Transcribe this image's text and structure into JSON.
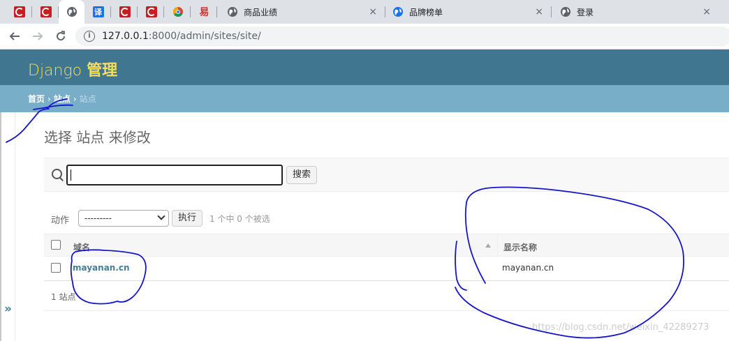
{
  "browser": {
    "tabs": [
      {
        "icon": "csdn-icon"
      },
      {
        "icon": "csdn-icon"
      },
      {
        "icon": "globe-icon",
        "active": true
      },
      {
        "icon": "translate-icon",
        "glyph": "译"
      },
      {
        "icon": "csdn-icon"
      },
      {
        "icon": "csdn-icon"
      },
      {
        "icon": "chrome-icon"
      },
      {
        "icon": "yi-icon",
        "glyph": "易"
      },
      {
        "icon": "globe-icon",
        "title": "商品业绩"
      },
      {
        "icon": "globe-blue-icon",
        "title": "品牌榜单"
      },
      {
        "icon": "globe-icon",
        "title": "登录"
      }
    ],
    "close_glyph": "×",
    "url_host": "127.0.0.1",
    "url_rest": ":8000/admin/sites/site/"
  },
  "header": {
    "brand_latin": "Django",
    "brand_cjk": "管理",
    "brand_color": "#f5dd5d"
  },
  "breadcrumbs": {
    "home": "首页",
    "app": "站点",
    "current": "站点",
    "separator": "›"
  },
  "nav_toggle": "»",
  "page": {
    "heading": "选择 站点 来修改"
  },
  "search": {
    "button_label": "搜索",
    "value": ""
  },
  "actions": {
    "label": "动作",
    "selected_option": "---------",
    "run_label": "执行",
    "counter": "1 个中 0 个被选"
  },
  "table": {
    "columns": [
      "域名",
      "显示名称"
    ],
    "rows": [
      {
        "domain": "mayanan.cn",
        "display_name": "mayanan.cn"
      }
    ]
  },
  "paginator": "1 站点",
  "watermark": "https://blog.csdn.net/weixin_42289273",
  "colors": {
    "header_bg": "#417690",
    "breadcrumb_bg": "#79aec8",
    "link": "#447e9b"
  }
}
